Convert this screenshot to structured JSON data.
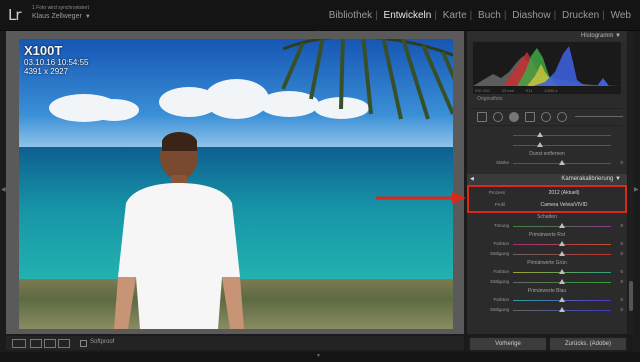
{
  "app": {
    "logo": "Lr",
    "sync_status": "1 Foto wird synchronisiert",
    "user_name": "Klaus Zellweger",
    "user_caret": "▼"
  },
  "modules": [
    "Bibliothek",
    "Entwickeln",
    "Karte",
    "Buch",
    "Diashow",
    "Drucken",
    "Web"
  ],
  "active_module": "Entwickeln",
  "photo_meta": {
    "camera": "X100T",
    "datetime": "03.10.16 10:54:55",
    "dimensions": "4391 x 2927"
  },
  "histogram": {
    "header": "Histogramm",
    "readout": [
      "ISO 200",
      "23 mm",
      "f/11",
      "1/500 s"
    ],
    "original_photo": "Originalfoto"
  },
  "panel": {
    "dunst": {
      "title": "Dunst entfernen",
      "label": "Stärke",
      "value": "0"
    },
    "calibration": {
      "title": "Kamerakalibrierung",
      "process_label": "Prozess",
      "process_value": "2012 (Aktuell)",
      "profile_label": "Profil",
      "profile_value": "Camera Velvia/VIVID"
    },
    "shadows": {
      "title": "Schatten",
      "label": "Tönung",
      "value": "0"
    },
    "red": {
      "title": "Primärwerte Rot",
      "hue_label": "Farbton",
      "sat_label": "Sättigung",
      "hue": "0",
      "sat": "0"
    },
    "green": {
      "title": "Primärwerte Grün",
      "hue_label": "Farbton",
      "sat_label": "Sättigung",
      "hue": "0",
      "sat": "0"
    },
    "blue": {
      "title": "Primärwerte Blau",
      "hue_label": "Farbton",
      "sat_label": "Sättigung",
      "hue": "0",
      "sat": "0"
    }
  },
  "bottom": {
    "softproof": "Softproof",
    "prev_button": "Vorherige",
    "reset_button": "Zurücks. (Adobe)"
  },
  "colors": {
    "accent_red": "#d8291c",
    "panel_bg": "#2b2b2b",
    "topbar_bg": "#141414"
  }
}
